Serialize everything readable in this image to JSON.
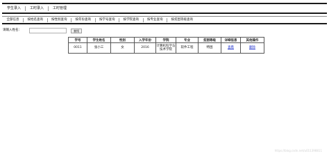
{
  "menu": [
    "学生录入",
    "工时录入",
    "工时管理"
  ],
  "subnav": [
    "全部信息",
    "按姓名查询",
    "按性别查询",
    "按年份查询",
    "按学号查询",
    "按学院查询",
    "按专业查询",
    "按贫困等级查询"
  ],
  "search": {
    "label": "请输入姓名：",
    "value": "",
    "button": "查找"
  },
  "table": {
    "headers": [
      "学号",
      "学生姓名",
      "性别",
      "入学年份",
      "学院",
      "专业",
      "贫困等级",
      "详细信息",
      "其他操作"
    ],
    "rows": [
      {
        "id": "0011",
        "name": "张小三",
        "gender": "女",
        "year": "2016",
        "college": "计算机科学与技术学院",
        "major": "软件工程",
        "level": "特困",
        "detail": "查看",
        "action": "删除"
      }
    ]
  },
  "watermark": "https://blog.csdn.net/u011398811"
}
